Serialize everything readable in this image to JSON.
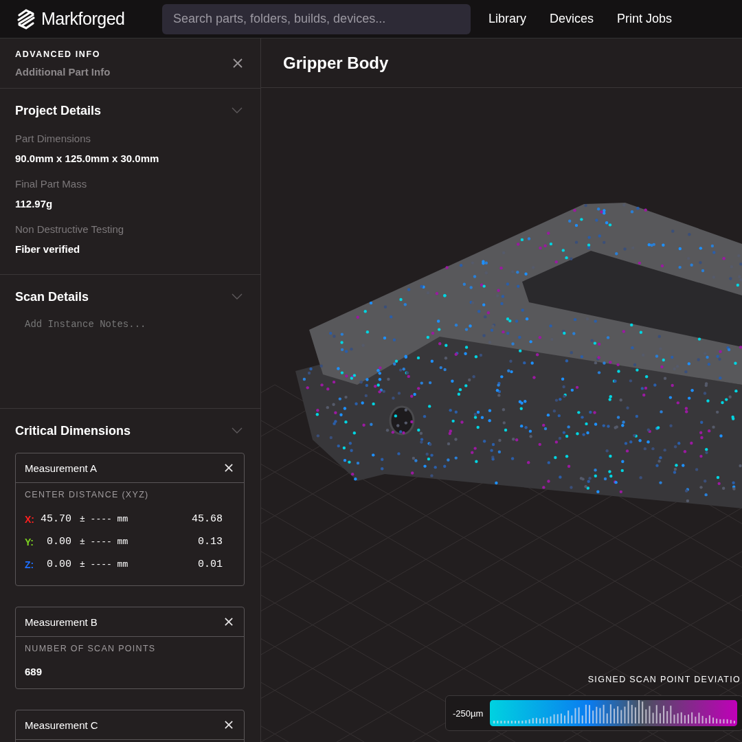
{
  "header": {
    "logo": "Markforged",
    "search": {
      "placeholder": "Search parts, folders, builds, devices..."
    },
    "nav": [
      {
        "label": "Library"
      },
      {
        "label": "Devices"
      },
      {
        "label": "Print Jobs"
      }
    ]
  },
  "panel": {
    "kicker": "ADVANCED INFO",
    "subtitle": "Additional Part Info",
    "sections": [
      {
        "kind": "fields",
        "title": "Project Details",
        "fields": [
          {
            "label": "Part Dimensions",
            "value": "90.0mm x 125.0mm x 30.0mm"
          },
          {
            "label": "Final Part Mass",
            "value": "112.97g"
          },
          {
            "label": "Non Destructive Testing",
            "value": "Fiber verified"
          }
        ]
      },
      {
        "kind": "notes",
        "title": "Scan Details",
        "placeholder": "Add Instance Notes..."
      },
      {
        "kind": "measurements",
        "title": "Critical Dimensions",
        "measurements": [
          {
            "kind": "xyz",
            "title": "Measurement A",
            "caption": "CENTER DISTANCE (XYZ)",
            "rows": [
              {
                "axis": "X:",
                "color": "#ff2020",
                "nominal": "45.70",
                "tolerance": "± ---- mm",
                "measured": "45.68"
              },
              {
                "axis": "Y:",
                "color": "#7ed321",
                "nominal": "0.00",
                "tolerance": "± ---- mm",
                "measured": "0.13"
              },
              {
                "axis": "Z:",
                "color": "#1e6fff",
                "nominal": "0.00",
                "tolerance": "± ---- mm",
                "measured": "0.01"
              }
            ]
          },
          {
            "kind": "count",
            "title": "Measurement B",
            "caption": "NUMBER OF SCAN POINTS",
            "value": "689"
          },
          {
            "kind": "collapsed",
            "title": "Measurement C"
          }
        ]
      }
    ]
  },
  "viewer": {
    "title": "Gripper Body",
    "legend": {
      "title": "SIGNED SCAN POINT DEVIATIO",
      "min_label": "-250µm"
    }
  }
}
